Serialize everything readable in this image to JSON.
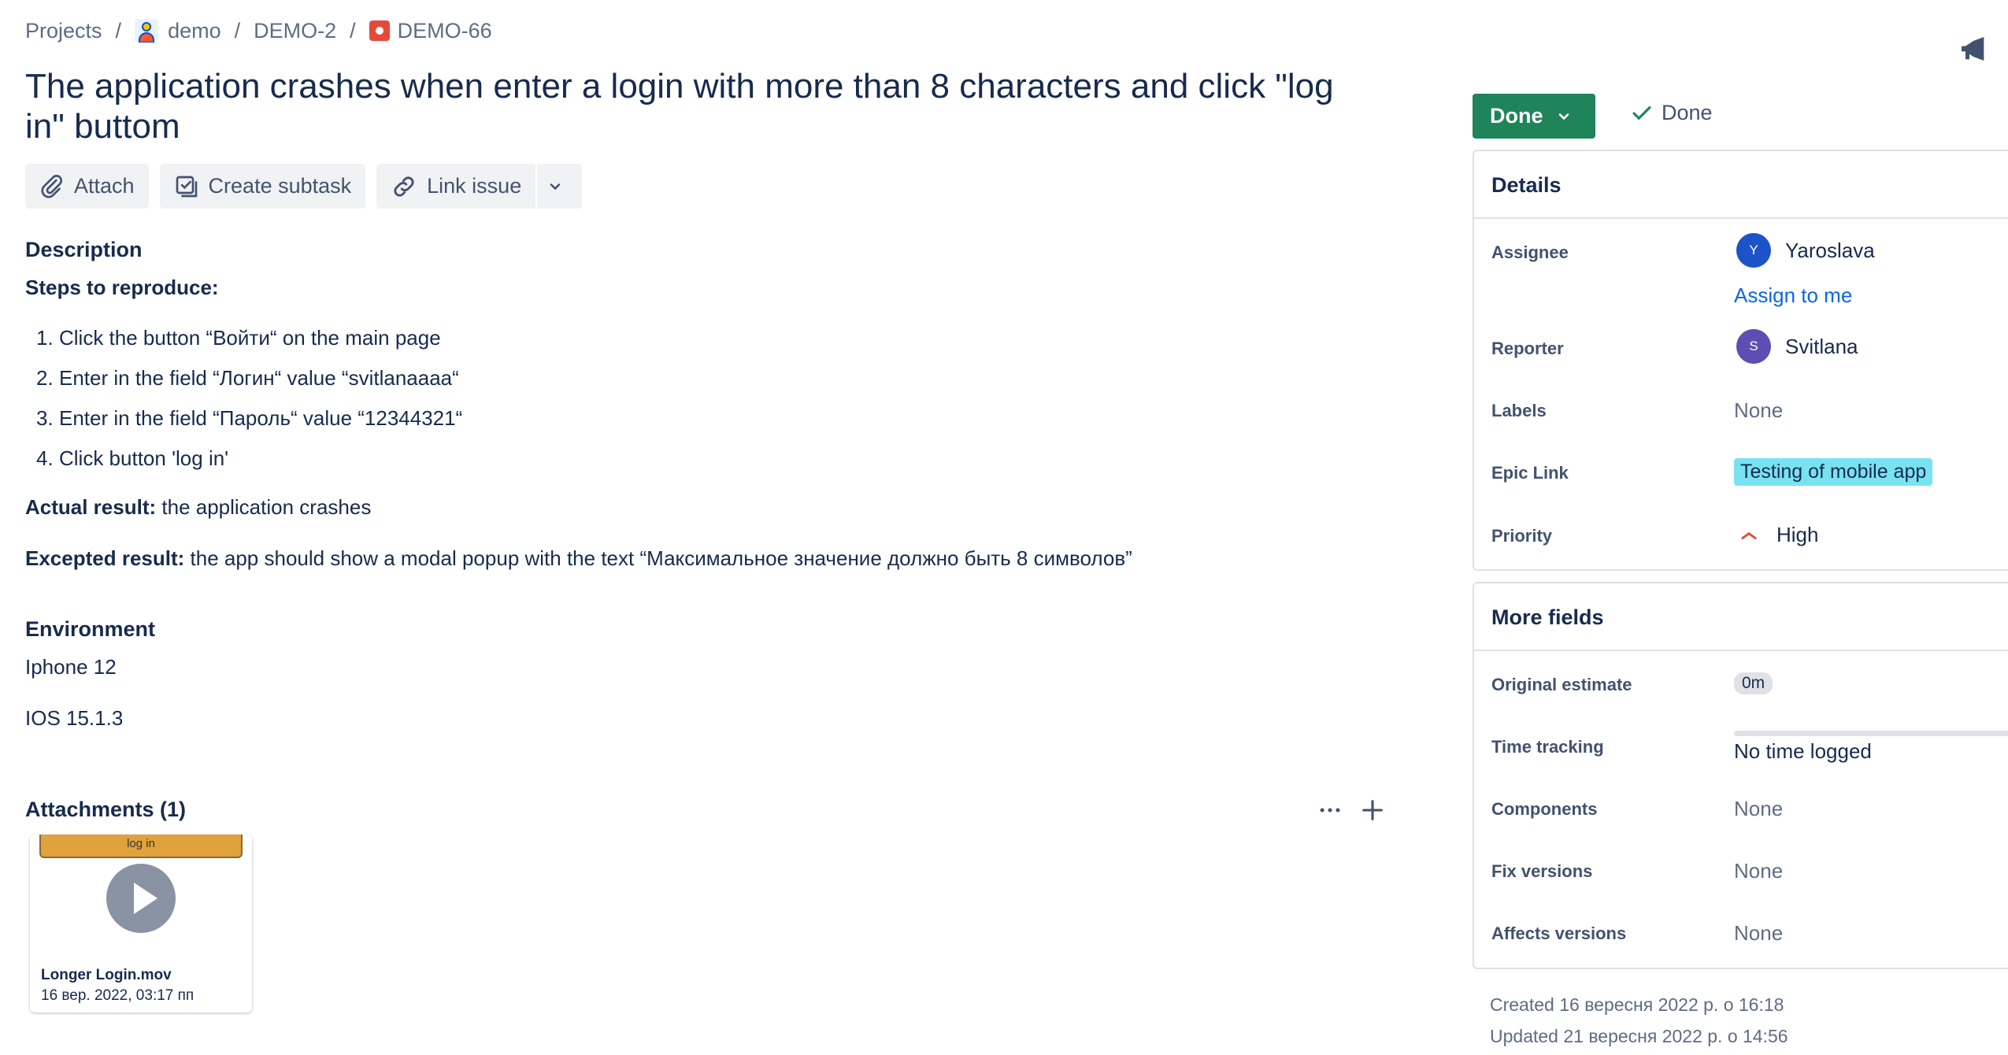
{
  "breadcrumb": {
    "items": [
      "Projects",
      "demo",
      "DEMO-2",
      "DEMO-66"
    ],
    "separator": "/"
  },
  "issue": {
    "title": "The application crashes when enter a login with more than 8 characters and click \"log in\" buttom"
  },
  "actions": {
    "attach": "Attach",
    "create_subtask": "Create subtask",
    "link_issue": "Link issue"
  },
  "description": {
    "heading": "Description",
    "steps_heading": "Steps to reproduce:",
    "steps": [
      {
        "num": "1.",
        "text": "Click the button “Войти“ on the main page"
      },
      {
        "num": "2.",
        "text": "Enter in the field “Логин“ value “svitlanaaaa“"
      },
      {
        "num": "3.",
        "text": "Enter in the field “Пароль“ value “12344321“"
      },
      {
        "num": "4.",
        "text": "Click button 'log in'"
      }
    ],
    "actual_label": "Actual result:",
    "actual_text": " the application crashes",
    "expected_label": "Excepted result:",
    "expected_text": " the app should show a modal popup with the text “Максимальное значение должно быть 8 символов”"
  },
  "environment": {
    "heading": "Environment",
    "lines": [
      "Iphone 12",
      "IOS 15.1.3"
    ]
  },
  "attachments": {
    "heading": "Attachments (1)",
    "more_icon": "more-horizontal-icon",
    "add_icon": "plus-icon",
    "items": [
      {
        "thumb_text": "log in",
        "name": "Longer Login.mov",
        "date": "16 вер. 2022, 03:17 пп"
      }
    ]
  },
  "status": {
    "label": "Done",
    "resolution": "Done",
    "color": "#1f845a"
  },
  "details": {
    "heading": "Details",
    "assignee_label": "Assignee",
    "assignee": {
      "initial": "Y",
      "name": "Yaroslava",
      "color": "#1d53c9"
    },
    "assign_to_me": "Assign to me",
    "reporter_label": "Reporter",
    "reporter": {
      "initial": "S",
      "name": "Svitlana",
      "color": "#5e4db2"
    },
    "labels_label": "Labels",
    "labels_value": "None",
    "epic_label": "Epic Link",
    "epic_value": "Testing of mobile app",
    "epic_color": "#79e2f2",
    "priority_label": "Priority",
    "priority_value": "High",
    "priority_color": "#e5493a"
  },
  "more_fields": {
    "heading": "More fields",
    "original_estimate_label": "Original estimate",
    "original_estimate_value": "0m",
    "time_tracking_label": "Time tracking",
    "time_tracking_value": "No time logged",
    "components_label": "Components",
    "components_value": "None",
    "fix_versions_label": "Fix versions",
    "fix_versions_value": "None",
    "affects_versions_label": "Affects versions",
    "affects_versions_value": "None"
  },
  "meta": {
    "created": "Created 16 вересня 2022 р. о 16:18",
    "updated": "Updated 21 вересня 2022 р. о 14:56"
  }
}
